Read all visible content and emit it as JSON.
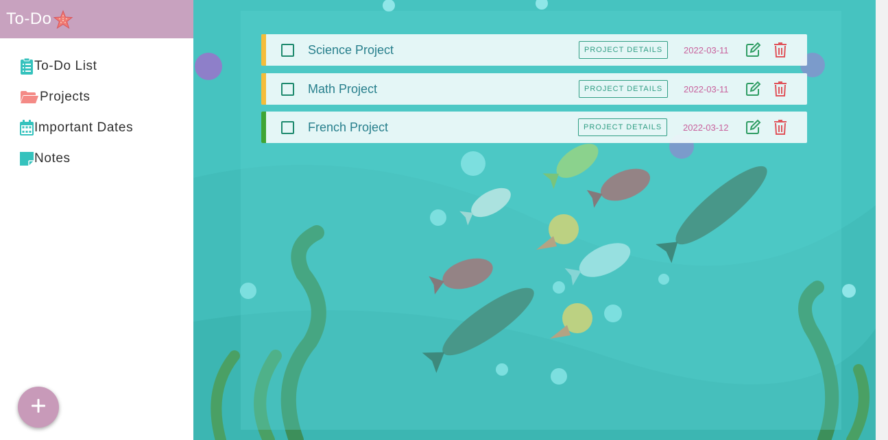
{
  "sidebar": {
    "brand": "To-Do",
    "brand_icon": "starfish-icon",
    "items": [
      {
        "label": "To-Do List",
        "icon": "clipboard-list-icon"
      },
      {
        "label": "Projects",
        "icon": "folder-open-icon"
      },
      {
        "label": "Important Dates",
        "icon": "calendar-icon"
      },
      {
        "label": "Notes",
        "icon": "sticky-note-icon"
      }
    ],
    "add_button_icon": "plus-icon"
  },
  "tasks": [
    {
      "title": "Science Project",
      "details_label": "PROJECT DETAILS",
      "date": "2022-03-11",
      "priority_color": "#f5bd3a"
    },
    {
      "title": "Math Project",
      "details_label": "PROJECT DETAILS",
      "date": "2022-03-11",
      "priority_color": "#f5bd3a"
    },
    {
      "title": "French Project",
      "details_label": "PROJECT DETAILS",
      "date": "2022-03-12",
      "priority_color": "#3fa534"
    }
  ],
  "colors": {
    "brand_bg": "#c8a2bf",
    "accent_teal": "#2aa8a0",
    "edit_green": "#2f9d63",
    "delete_red": "#e0535a",
    "date_pink": "#c8609c"
  }
}
